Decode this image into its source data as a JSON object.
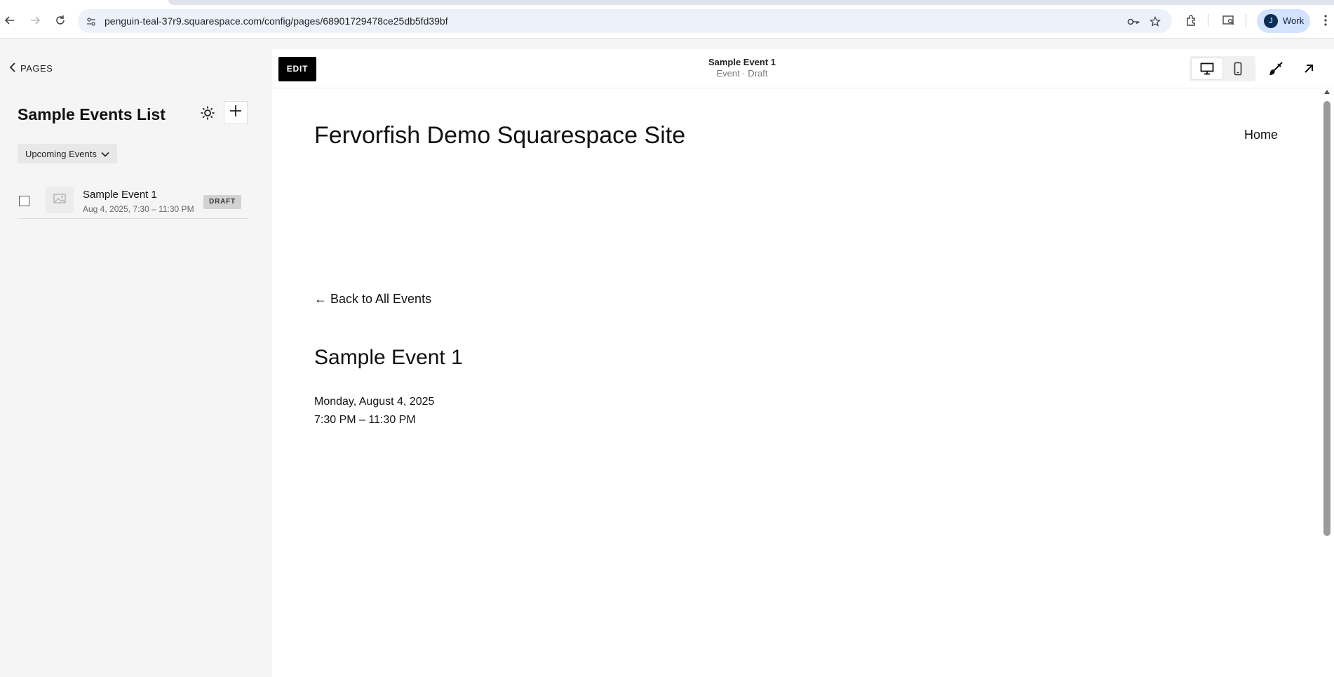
{
  "browser": {
    "url": "penguin-teal-37r9.squarespace.com/config/pages/68901729478ce25db5fd39bf",
    "profile_initial": "J",
    "profile_label": "Work"
  },
  "sidebar": {
    "back_label": "PAGES",
    "title": "Sample Events List",
    "filter_label": "Upcoming Events",
    "items": [
      {
        "name": "Sample Event 1",
        "date": "Aug 4, 2025, 7:30 – 11:30 PM",
        "badge": "DRAFT"
      }
    ]
  },
  "editor": {
    "edit_label": "EDIT",
    "page_title": "Sample Event 1",
    "page_subtitle": "Event · Draft"
  },
  "site": {
    "title": "Fervorfish Demo Squarespace Site",
    "nav": [
      "Home"
    ],
    "back_link": "← Back to All Events",
    "event_title": "Sample Event 1",
    "event_date": "Monday, August 4, 2025",
    "event_time": "7:30 PM – 11:30 PM"
  }
}
